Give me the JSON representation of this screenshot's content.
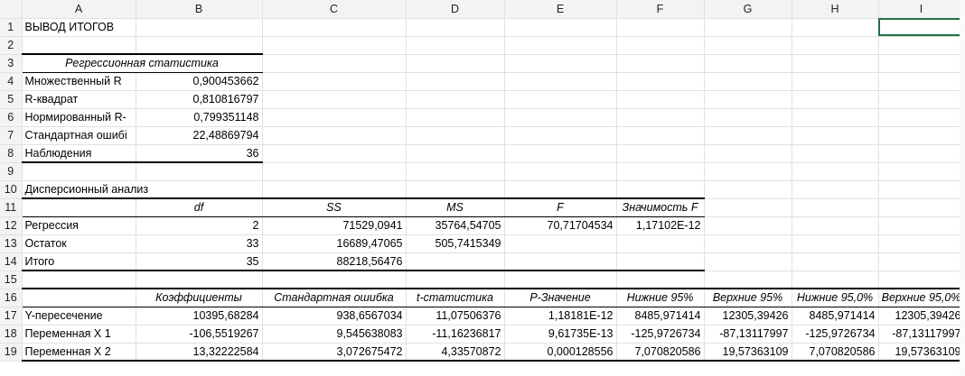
{
  "columns": [
    "A",
    "B",
    "C",
    "D",
    "E",
    "F",
    "G",
    "H",
    "I"
  ],
  "rows": [
    {
      "num": "1",
      "cells": [
        "ВЫВОД ИТОГОВ",
        "",
        "",
        "",
        "",
        "",
        "",
        "",
        ""
      ]
    },
    {
      "num": "2",
      "cells": [
        "",
        "",
        "",
        "",
        "",
        "",
        "",
        "",
        ""
      ]
    },
    {
      "num": "3",
      "cells": [
        "Регрессионная статистика",
        "",
        "",
        "",
        "",
        "",
        "",
        "",
        ""
      ]
    },
    {
      "num": "4",
      "cells": [
        "Множественный R",
        "0,900453662",
        "",
        "",
        "",
        "",
        "",
        "",
        ""
      ]
    },
    {
      "num": "5",
      "cells": [
        "R-квадрат",
        "0,810816797",
        "",
        "",
        "",
        "",
        "",
        "",
        ""
      ]
    },
    {
      "num": "6",
      "cells": [
        "Нормированный R-",
        "0,799351148",
        "",
        "",
        "",
        "",
        "",
        "",
        ""
      ]
    },
    {
      "num": "7",
      "cells": [
        "Стандартная ошибі",
        "22,48869794",
        "",
        "",
        "",
        "",
        "",
        "",
        ""
      ]
    },
    {
      "num": "8",
      "cells": [
        "Наблюдения",
        "36",
        "",
        "",
        "",
        "",
        "",
        "",
        ""
      ]
    },
    {
      "num": "9",
      "cells": [
        "",
        "",
        "",
        "",
        "",
        "",
        "",
        "",
        ""
      ]
    },
    {
      "num": "10",
      "cells": [
        "Дисперсионный анализ",
        "",
        "",
        "",
        "",
        "",
        "",
        "",
        ""
      ]
    },
    {
      "num": "11",
      "cells": [
        "",
        "df",
        "SS",
        "MS",
        "F",
        "Значимость F",
        "",
        "",
        ""
      ]
    },
    {
      "num": "12",
      "cells": [
        "Регрессия",
        "2",
        "71529,0941",
        "35764,54705",
        "70,71704534",
        "1,17102E-12",
        "",
        "",
        ""
      ]
    },
    {
      "num": "13",
      "cells": [
        "Остаток",
        "33",
        "16689,47065",
        "505,7415349",
        "",
        "",
        "",
        "",
        ""
      ]
    },
    {
      "num": "14",
      "cells": [
        "Итого",
        "35",
        "88218,56476",
        "",
        "",
        "",
        "",
        "",
        ""
      ]
    },
    {
      "num": "15",
      "cells": [
        "",
        "",
        "",
        "",
        "",
        "",
        "",
        "",
        ""
      ]
    },
    {
      "num": "16",
      "cells": [
        "",
        "Коэффициенты",
        "Стандартная ошибка",
        "t-статистика",
        "P-Значение",
        "Нижние 95%",
        "Верхние 95%",
        "Нижние 95,0%",
        "Верхние 95,0%"
      ]
    },
    {
      "num": "17",
      "cells": [
        "Y-пересечение",
        "10395,68284",
        "938,6567034",
        "11,07506376",
        "1,18181E-12",
        "8485,971414",
        "12305,39426",
        "8485,971414",
        "12305,39426"
      ]
    },
    {
      "num": "18",
      "cells": [
        "Переменная X 1",
        "-106,5519267",
        "9,545638083",
        "-11,16236817",
        "9,61735E-13",
        "-125,9726734",
        "-87,13117997",
        "-125,9726734",
        "-87,13117997"
      ]
    },
    {
      "num": "19",
      "cells": [
        "Переменная X 2",
        "13,32222584",
        "3,072675472",
        "4,33570872",
        "0,000128556",
        "7,070820586",
        "19,57363109",
        "7,070820586",
        "19,57363109"
      ]
    }
  ]
}
